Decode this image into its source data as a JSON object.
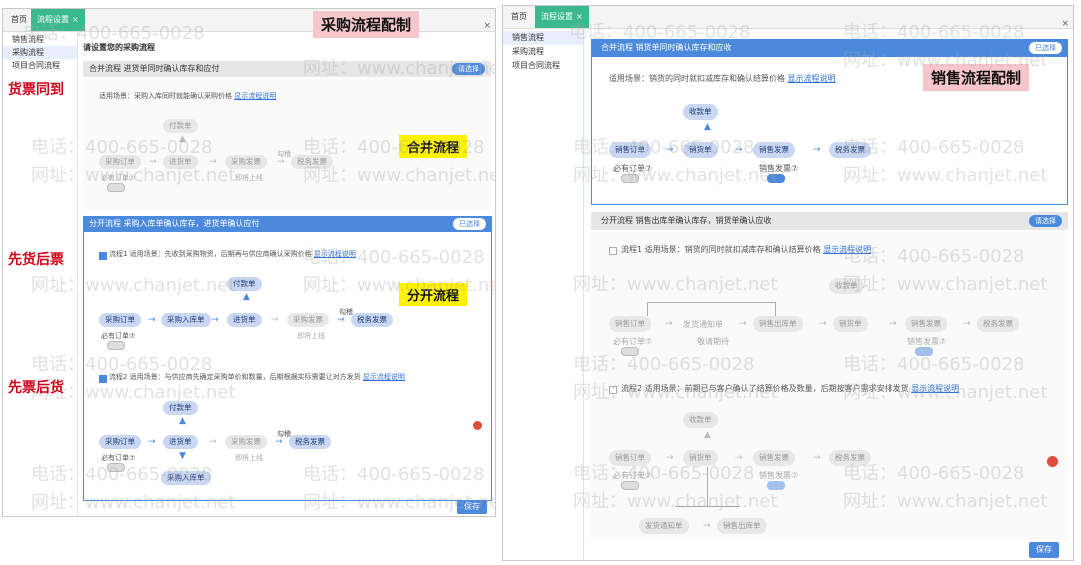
{
  "left": {
    "tabs": [
      "首页",
      "流程设置"
    ],
    "sidebar": [
      "销售流程",
      "采购流程",
      "项目合同流程"
    ],
    "heading": "请设置您的采购流程",
    "banner": "采购流程配制",
    "merge": {
      "bar_title": "合并流程  进货单同时确认库存和应付",
      "button": "请选择",
      "scene_prefix": "适用场景：采购入库同时就能确认采购价格",
      "scene_link": "显示流程说明",
      "nodes": [
        "付款单",
        "采购订单",
        "进货单",
        "采购发票",
        "税务发票"
      ],
      "must_order": "必有订单",
      "coming": "即将上线",
      "check": "勾稽",
      "tag": "合并流程"
    },
    "split": {
      "bar_title": "分开流程  采购入库单确认库存，进货单确认应付",
      "button": "已选择",
      "tag": "分开流程",
      "flow1": {
        "label": "流程1  适用场景：先收到采购物资，后期再与供应商确认采购价格",
        "link": "显示流程说明",
        "nodes": [
          "付款单",
          "采购订单",
          "采购入库单",
          "进货单",
          "采购发票",
          "税务发票"
        ]
      },
      "flow2": {
        "label": "流程2  适用场景：与供应商先确定采购单价和数量，后期根据实际需要让对方发货",
        "link": "显示流程说明",
        "nodes": [
          "付款单",
          "采购订单",
          "进货单",
          "采购发票",
          "税务发票",
          "采购入库单"
        ]
      },
      "must_order": "必有订单",
      "coming": "即将上线",
      "check": "勾稽"
    },
    "red_labels": [
      "货票同到",
      "先货后票",
      "先票后货"
    ],
    "save": "保存",
    "close": "×"
  },
  "right": {
    "tabs": [
      "首页",
      "流程设置"
    ],
    "sidebar": [
      "销售流程",
      "采购流程",
      "项目合同流程"
    ],
    "banner": "销售流程配制",
    "merge": {
      "bar_title": "合并流程  销货单同时确认库存和应收",
      "button": "已选择",
      "scene_prefix": "适用场景：销货的同时就扣减库存和确认结算价格",
      "scene_link": "显示流程说明",
      "nodes": [
        "收款单",
        "销售订单",
        "销货单",
        "销售发票",
        "税务发票"
      ],
      "must_order": "必有订单",
      "must_invoice": "销售发票"
    },
    "split": {
      "bar_title": "分开流程  销售出库单确认库存，销货单确认应收",
      "button": "请选择",
      "flow1": {
        "label": "流程1  适用场景：销货的同时就扣减库存和确认结算价格",
        "link": "显示流程说明",
        "nodes": [
          "收款单",
          "销售订单",
          "发货通知单",
          "销售出库单",
          "销货单",
          "销售发票",
          "税务发票"
        ],
        "wait": "敬请期待"
      },
      "flow2": {
        "label": "流程2  适用场景：前期已与客户确认了结算价格及数量，后期按客户需求安排发货",
        "link": "显示流程说明",
        "nodes": [
          "收款单",
          "销售订单",
          "销货单",
          "销售发票",
          "税务发票",
          "发货通知单",
          "销售出库单"
        ]
      },
      "must_order": "必有订单",
      "must_invoice": "销售发票"
    },
    "save": "保存",
    "close": "×"
  },
  "watermarks": [
    "电话：400-665-0028",
    "网址：www.chanjet.net"
  ]
}
